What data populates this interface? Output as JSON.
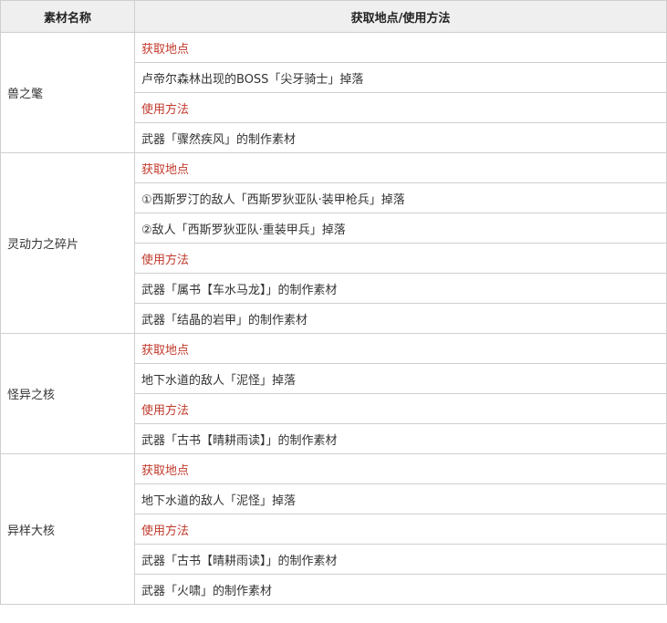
{
  "header": {
    "col_name": "素材名称",
    "col_info": "获取地点/使用方法"
  },
  "materials": [
    {
      "name": "兽之氅",
      "rows": [
        {
          "type": "section",
          "text": "获取地点"
        },
        {
          "type": "detail",
          "text": "卢帝尔森林出现的BOSS「尖牙骑士」掉落"
        },
        {
          "type": "section",
          "text": "使用方法"
        },
        {
          "type": "detail",
          "text": "武器「骤然疾风」的制作素材"
        }
      ]
    },
    {
      "name": "灵动力之碎片",
      "rows": [
        {
          "type": "section",
          "text": "获取地点"
        },
        {
          "type": "detail",
          "text": "①西斯罗汀的敌人「西斯罗狄亚队·装甲枪兵」掉落"
        },
        {
          "type": "detail",
          "text": "②敌人「西斯罗狄亚队·重装甲兵」掉落"
        },
        {
          "type": "section",
          "text": "使用方法"
        },
        {
          "type": "detail",
          "text": "武器「属书【车水马龙】」的制作素材"
        },
        {
          "type": "detail",
          "text": "武器「结晶的岩甲」的制作素材"
        }
      ]
    },
    {
      "name": "怪异之核",
      "rows": [
        {
          "type": "section",
          "text": "获取地点"
        },
        {
          "type": "detail",
          "text": "地下水道的敌人「泥怪」掉落"
        },
        {
          "type": "section",
          "text": "使用方法"
        },
        {
          "type": "detail",
          "text": "武器「古书【晴耕雨读】」的制作素材"
        }
      ]
    },
    {
      "name": "异样大核",
      "rows": [
        {
          "type": "section",
          "text": "获取地点"
        },
        {
          "type": "detail",
          "text": "地下水道的敌人「泥怪」掉落"
        },
        {
          "type": "section",
          "text": "使用方法"
        },
        {
          "type": "detail",
          "text": "武器「古书【晴耕雨读】」的制作素材"
        },
        {
          "type": "detail",
          "text": "武器「火啸」的制作素材"
        }
      ]
    }
  ],
  "colors": {
    "section_text": "#c0392b",
    "header_bg": "#efefef",
    "border": "#cfcfcf"
  }
}
